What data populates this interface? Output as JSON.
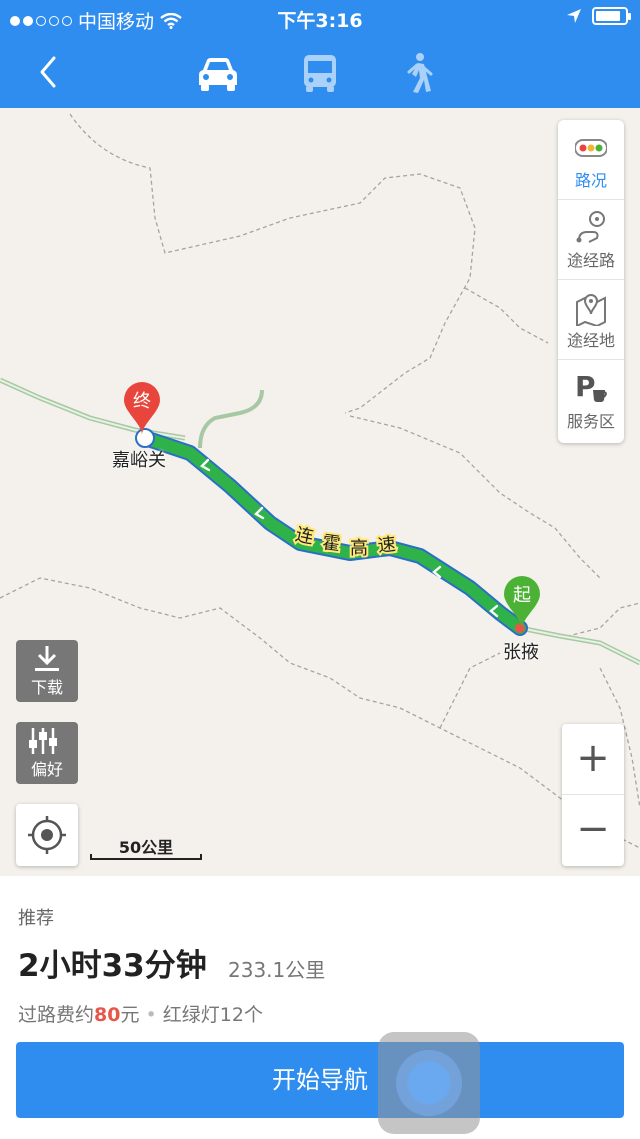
{
  "status_bar": {
    "carrier": "中国移动",
    "time": "下午3:16"
  },
  "nav": {
    "back_icon": "chevron-left-icon",
    "modes": [
      "car-icon",
      "bus-icon",
      "walk-icon"
    ],
    "selected_mode": "car"
  },
  "map": {
    "road_name": "连霍高速",
    "start": {
      "marker": "起",
      "city": "张掖"
    },
    "end": {
      "marker": "终",
      "city": "嘉峪关"
    },
    "scale_label": "50公里",
    "side_panel": [
      {
        "label": "路况",
        "icon": "traffic-light-icon"
      },
      {
        "label": "途经路",
        "icon": "route-via-icon"
      },
      {
        "label": "途经地",
        "icon": "map-pin-icon"
      },
      {
        "label": "服务区",
        "icon": "parking-cafe-icon"
      }
    ],
    "download_label": "下载",
    "preference_label": "偏好",
    "zoom_in": "+",
    "zoom_out": "−",
    "colors": {
      "route": "#2fb24a",
      "start_pin": "#4cb236",
      "end_pin": "#e8463c"
    }
  },
  "card": {
    "recommend": "推荐",
    "duration": "2小时33分钟",
    "distance": "233.1公里",
    "toll_prefix": "过路费约",
    "toll_value": "80",
    "toll_unit": "元",
    "separator": "•",
    "lights_label": "红绿灯12个",
    "start_button": "开始导航"
  }
}
